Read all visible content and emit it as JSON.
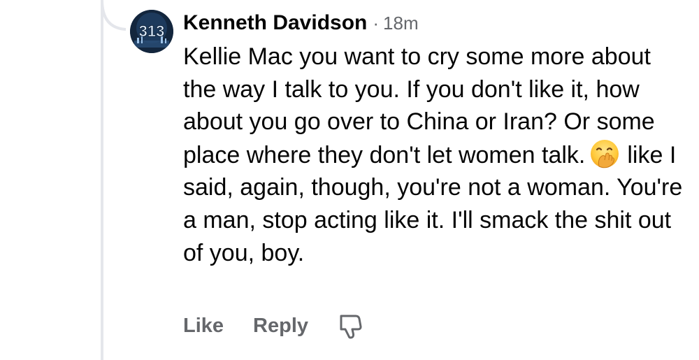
{
  "comment": {
    "author": "Kenneth Davidson",
    "separator": "·",
    "timestamp": "18m",
    "avatar_text": "313",
    "text_before_emoji": "Kellie Mac you want to cry some more about the way I talk to you. If you don't like it, how about you go over to China or Iran? Or some place where they don't let women talk.",
    "emoji": "face-with-hand-over-mouth-emoji",
    "text_after_emoji": "like I said, again, though, you're not a woman. You're a man, stop acting like it. I'll smack the shit out of you, boy."
  },
  "actions": {
    "like_label": "Like",
    "reply_label": "Reply",
    "dislike_icon": "thumbs-down-icon"
  },
  "colors": {
    "text": "#050505",
    "secondary": "#65676b",
    "thread_line": "#e4e6eb",
    "background": "#ffffff"
  }
}
